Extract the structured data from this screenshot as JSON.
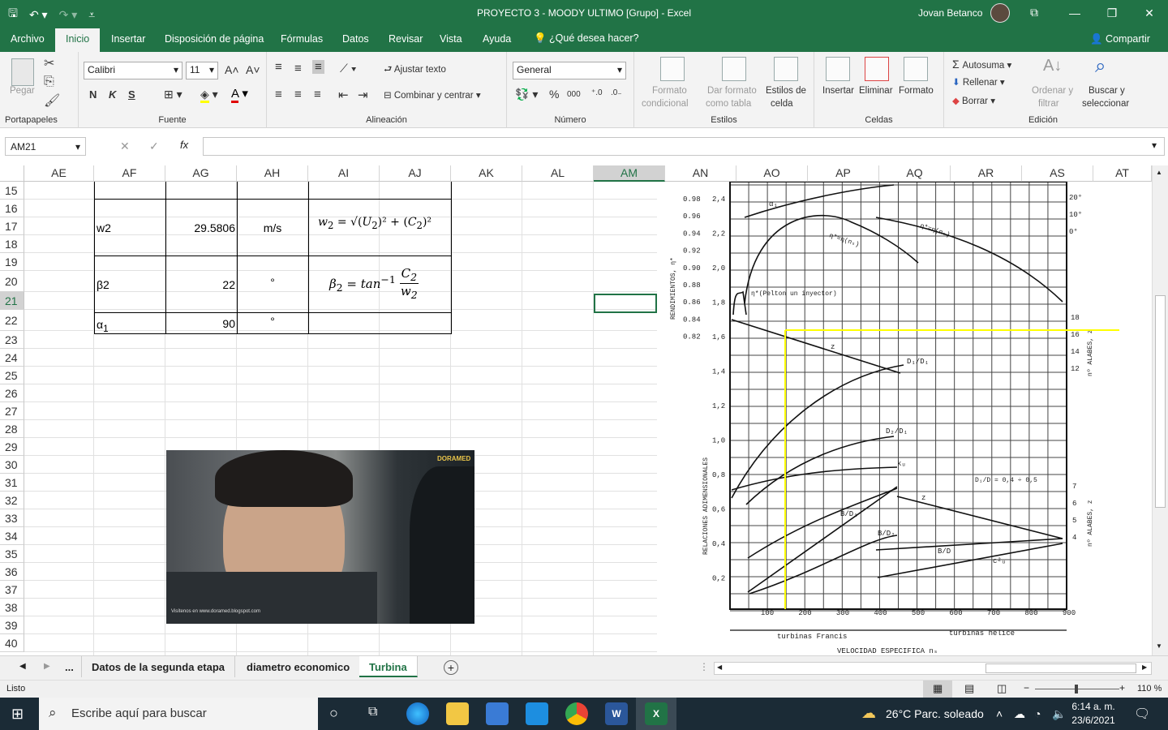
{
  "titlebar": {
    "title": "PROYECTO 3 - MOODY ULTIMO  [Grupo]  -  Excel",
    "user": "Jovan Betanco"
  },
  "tabs": [
    "Archivo",
    "Inicio",
    "Insertar",
    "Disposición de página",
    "Fórmulas",
    "Datos",
    "Revisar",
    "Vista",
    "Ayuda"
  ],
  "tell_me": "¿Qué desea hacer?",
  "share": "Compartir",
  "ribbon": {
    "clipboard": {
      "paste": "Pegar",
      "label": "Portapapeles"
    },
    "font": {
      "name": "Calibri",
      "size": "11",
      "bold": "N",
      "italic": "K",
      "underline": "S",
      "label": "Fuente"
    },
    "alignment": {
      "wrap": "Ajustar texto",
      "merge": "Combinar y centrar",
      "label": "Alineación"
    },
    "number": {
      "format": "General",
      "percent": "%",
      "thousands": "000",
      "label": "Número"
    },
    "styles": {
      "conditional1": "Formato",
      "conditional2": "condicional",
      "table1": "Dar formato",
      "table2": "como tabla",
      "cell1": "Estilos de",
      "cell2": "celda",
      "label": "Estilos"
    },
    "cells": {
      "insert": "Insertar",
      "delete": "Eliminar",
      "format": "Formato",
      "label": "Celdas"
    },
    "editing": {
      "autosum": "Autosuma",
      "fill": "Rellenar",
      "clear": "Borrar",
      "sort1": "Ordenar y",
      "sort2": "filtrar",
      "find1": "Buscar y",
      "find2": "seleccionar",
      "label": "Edición"
    }
  },
  "namebox": "AM21",
  "fx": "fx",
  "columns": [
    "AE",
    "AF",
    "AG",
    "AH",
    "AI",
    "AJ",
    "AK",
    "AL",
    "AM",
    "AN",
    "AO",
    "AP",
    "AQ",
    "AR",
    "AS",
    "AT"
  ],
  "rows": [
    "15",
    "16",
    "17",
    "18",
    "19",
    "20",
    "21",
    "22",
    "23",
    "24",
    "25",
    "26",
    "27",
    "28",
    "29",
    "30",
    "31",
    "32",
    "33",
    "34",
    "35",
    "36",
    "37",
    "38",
    "39",
    "40"
  ],
  "table": {
    "w2_label": "w2",
    "w2_value": "29.5806",
    "w2_unit": "m/s",
    "beta_label": "β2",
    "beta_value": "22",
    "beta_unit": "°",
    "alpha_label": "α",
    "alpha_sub": "1",
    "alpha_value": "90",
    "alpha_unit": "°"
  },
  "photo_watermark": "DORAMED",
  "photo_caption": "Visítenos en www.doramed.blogspot.com",
  "chart_image": {
    "top_left": [
      "0.98",
      "0.96",
      "0.94",
      "0.92",
      "0.90",
      "0.88",
      "0.86",
      "0.84",
      "0.82"
    ],
    "mid_left": [
      "2,4",
      "2,2",
      "2,0",
      "1,8",
      "1,6",
      "1,4",
      "1,2",
      "1,0",
      "0,8",
      "0,6",
      "0,4",
      "0,2"
    ],
    "right_top": [
      "20°",
      "10°",
      "0°"
    ],
    "right_z_top": [
      "18",
      "16",
      "14",
      "12"
    ],
    "right_z_bottom": [
      "7",
      "6",
      "5",
      "4"
    ],
    "x_ticks": [
      "100",
      "200",
      "300",
      "400",
      "500",
      "600",
      "700",
      "800",
      "900"
    ],
    "ylabel_top": "RENDIMIENTOS, η*",
    "ylabel_bottom": "RELACIONES ADIMENSIONALES",
    "ylabel_right_top": "nº ALABES, z",
    "ylabel_right_bottom": "nº ALABES, z",
    "francis": "turbinas Francis",
    "helice": "turbinas hélice",
    "xlabel": "VELOCIDAD ESPECIFICA nₛ",
    "note_pelton": "η*(Pelton un inyector)",
    "ratio": "D₁/D = 0,4 ÷ 0,5",
    "curve_d1d1": "D₁/D₁",
    "curve_d2d1": "D₂/D₁",
    "curve_ku": "kᵤ",
    "curve_bd1": "B/D₁",
    "curve_bd2": "B/D₂",
    "curve_bd": "B/D",
    "curve_cu": "c²ᵤ",
    "curve_z": "z",
    "curve_a1": "α₁",
    "curve_eta1": "η*=η(nₛ)",
    "curve_eta2": "η*=η(nₛ)"
  },
  "sheets": [
    "...",
    "Datos de la segunda etapa",
    "diametro economico",
    "Turbina"
  ],
  "status": {
    "ready": "Listo",
    "zoom": "110 %"
  },
  "taskbar": {
    "search": "Escribe aquí para buscar",
    "weather": "26°C  Parc. soleado",
    "time": "6:14 a. m.",
    "date": "23/6/2021"
  },
  "colors": {
    "excel_green": "#217346",
    "highlight": "#ffff00"
  }
}
